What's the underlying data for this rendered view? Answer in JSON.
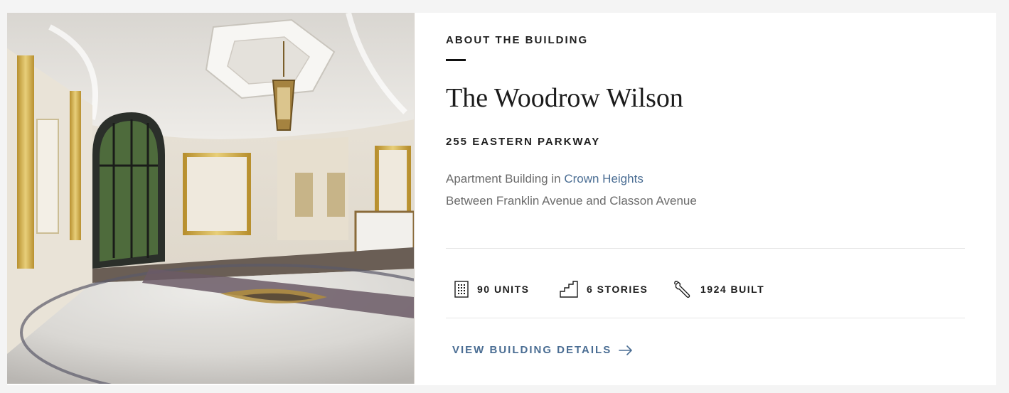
{
  "about": {
    "eyebrow": "ABOUT THE BUILDING",
    "title": "The Woodrow Wilson",
    "address": "255 EASTERN PARKWAY",
    "type_prefix": "Apartment Building in ",
    "neighborhood": "Crown Heights",
    "cross_streets": "Between Franklin Avenue and Classon Avenue"
  },
  "stats": [
    {
      "icon": "building-icon",
      "label": "90 UNITS"
    },
    {
      "icon": "stairs-icon",
      "label": "6 STORIES"
    },
    {
      "icon": "wrench-icon",
      "label": "1924 BUILT"
    }
  ],
  "cta": {
    "label": "VIEW BUILDING DETAILS",
    "icon": "arrow-right-icon"
  },
  "colors": {
    "link": "#4a6d93",
    "text": "#1c1c1c",
    "muted": "#6b6b6b",
    "background": "#f4f4f4"
  }
}
